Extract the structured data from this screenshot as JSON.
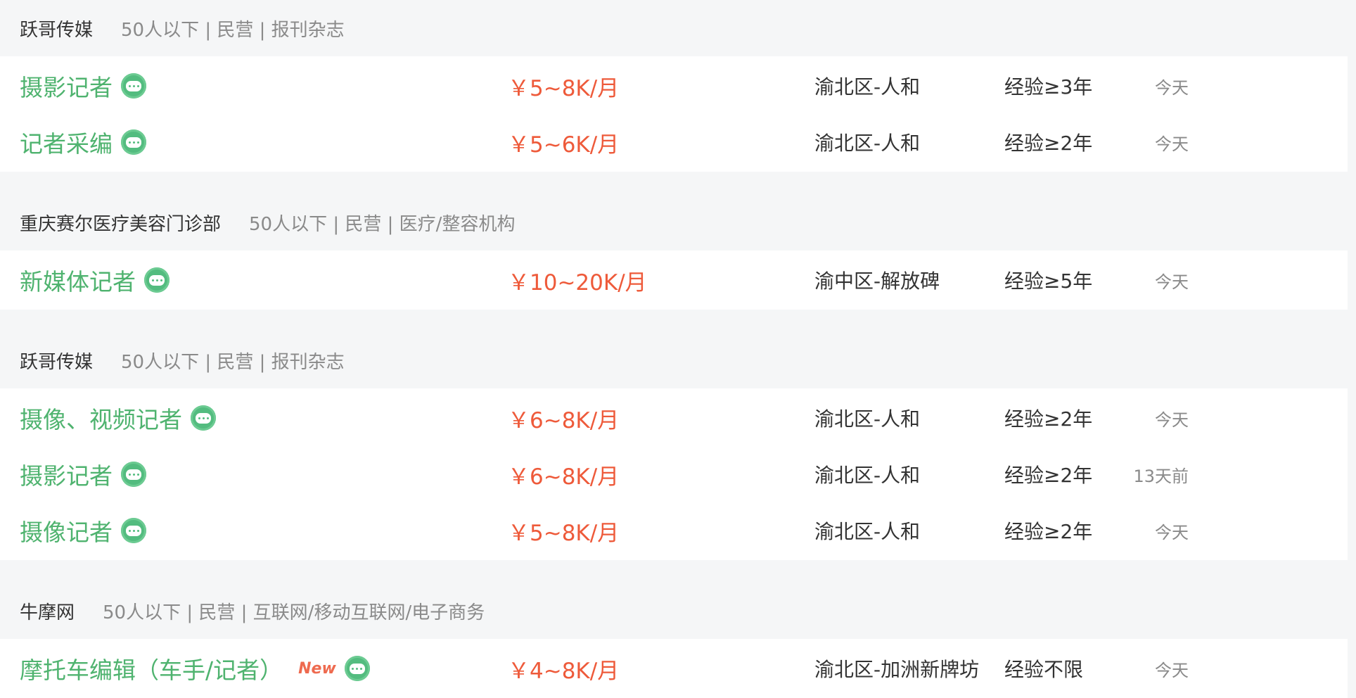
{
  "groups": [
    {
      "company": "跃哥传媒",
      "meta": "50人以下 | 民营 | 报刊杂志",
      "jobs": [
        {
          "title": "摄影记者",
          "isNew": false,
          "salary": "￥5~8K/月",
          "location": "渝北区-人和",
          "experience": "经验≥3年",
          "date": "今天"
        },
        {
          "title": "记者采编",
          "isNew": false,
          "salary": "￥5~6K/月",
          "location": "渝北区-人和",
          "experience": "经验≥2年",
          "date": "今天"
        }
      ]
    },
    {
      "company": "重庆赛尔医疗美容门诊部",
      "meta": "50人以下 | 民营 | 医疗/整容机构",
      "jobs": [
        {
          "title": "新媒体记者",
          "isNew": false,
          "salary": "￥10~20K/月",
          "location": "渝中区-解放碑",
          "experience": "经验≥5年",
          "date": "今天"
        }
      ]
    },
    {
      "company": "跃哥传媒",
      "meta": "50人以下 | 民营 | 报刊杂志",
      "jobs": [
        {
          "title": "摄像、视频记者",
          "isNew": false,
          "salary": "￥6~8K/月",
          "location": "渝北区-人和",
          "experience": "经验≥2年",
          "date": "今天"
        },
        {
          "title": "摄影记者",
          "isNew": false,
          "salary": "￥6~8K/月",
          "location": "渝北区-人和",
          "experience": "经验≥2年",
          "date": "13天前"
        },
        {
          "title": "摄像记者",
          "isNew": false,
          "salary": "￥5~8K/月",
          "location": "渝北区-人和",
          "experience": "经验≥2年",
          "date": "今天"
        }
      ]
    },
    {
      "company": "牛摩网",
      "meta": "50人以下 | 民营 | 互联网/移动互联网/电子商务",
      "jobs": [
        {
          "title": "摩托车编辑（车手/记者）",
          "isNew": true,
          "newLabel": "New",
          "salary": "￥4~8K/月",
          "location": "渝北区-加洲新牌坊",
          "experience": "经验不限",
          "date": "今天"
        }
      ]
    }
  ],
  "icons": {
    "chat": "chat-bubble-icon"
  },
  "colors": {
    "title": "#4fb36f",
    "salary": "#ee5a3a",
    "icon": "#53bc7f",
    "new": "#ee6a4f"
  }
}
